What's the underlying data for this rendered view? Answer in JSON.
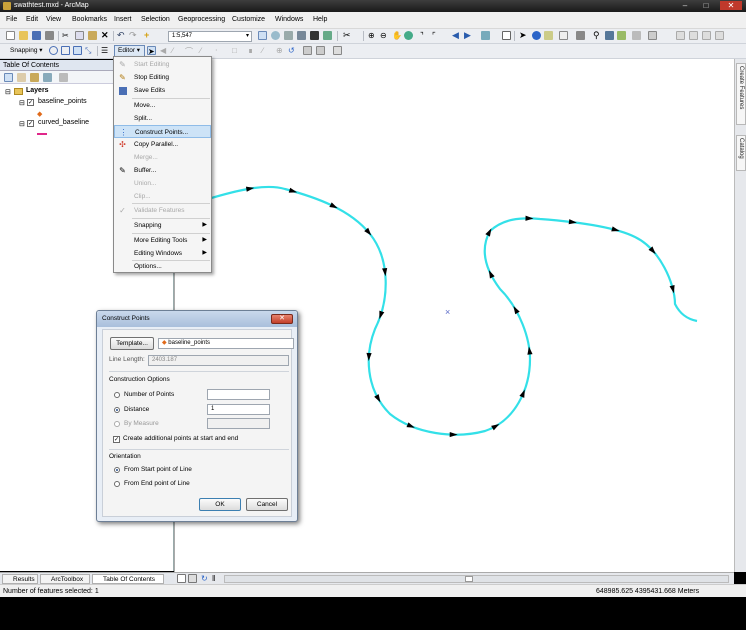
{
  "window": {
    "title": "swathtest.mxd - ArcMap"
  },
  "menubar": [
    "File",
    "Edit",
    "View",
    "Bookmarks",
    "Insert",
    "Selection",
    "Geoprocessing",
    "Customize",
    "Windows",
    "Help"
  ],
  "toolbar": {
    "scale": "1:5,547",
    "snapping_label": "Snapping ▾",
    "editor_label": "Editor ▾"
  },
  "toc": {
    "title": "Table Of Contents",
    "root": "Layers",
    "layers": [
      {
        "name": "baseline_points",
        "checked": true,
        "symbol_color": "#e06a1a"
      },
      {
        "name": "curved_baseline",
        "checked": true,
        "symbol_color": "#e0278a"
      }
    ]
  },
  "editor_menu": [
    {
      "label": "Start Editing",
      "enabled": false,
      "icon": "pencil-icon"
    },
    {
      "label": "Stop Editing",
      "enabled": true,
      "icon": "pencil-stop-icon"
    },
    {
      "label": "Save Edits",
      "enabled": true,
      "icon": "save-icon"
    },
    {
      "label": "Move...",
      "enabled": true
    },
    {
      "label": "Split...",
      "enabled": true
    },
    {
      "label": "Construct Points...",
      "enabled": true,
      "highlighted": true,
      "icon": "construct-points-icon"
    },
    {
      "label": "Copy Parallel...",
      "enabled": true,
      "icon": "copy-parallel-icon"
    },
    {
      "label": "Merge...",
      "enabled": false
    },
    {
      "label": "Buffer...",
      "enabled": true,
      "icon": "buffer-icon"
    },
    {
      "label": "Union...",
      "enabled": false
    },
    {
      "label": "Clip...",
      "enabled": false
    },
    {
      "label": "Validate Features",
      "enabled": false,
      "icon": "validate-icon"
    },
    {
      "label": "Snapping",
      "enabled": true,
      "submenu": true
    },
    {
      "label": "More Editing Tools",
      "enabled": true,
      "submenu": true
    },
    {
      "label": "Editing Windows",
      "enabled": true,
      "submenu": true
    },
    {
      "label": "Options...",
      "enabled": true
    }
  ],
  "dialog": {
    "title": "Construct Points",
    "template_button": "Template...",
    "template_value": "baseline_points",
    "line_length_label": "Line Length:",
    "line_length_value": "2403.187",
    "construction_options_label": "Construction Options",
    "number_of_points_label": "Number of Points",
    "number_of_points_value": "",
    "distance_label": "Distance",
    "distance_value": "1",
    "by_measure_label": "By Measure",
    "by_measure_value": "",
    "create_additional_label": "Create additional points at start and end",
    "create_additional_checked": true,
    "selected_option": "Distance",
    "orientation_label": "Orientation",
    "from_start_label": "From Start point of Line",
    "from_end_label": "From End point of Line",
    "selected_orientation": "From Start point of Line",
    "ok_label": "OK",
    "cancel_label": "Cancel"
  },
  "right_tabs": [
    "Create Features",
    "Catalog"
  ],
  "bottom_tabs": [
    "Results",
    "ArcToolbox",
    "Table Of Contents"
  ],
  "statusbar": {
    "left": "Number of features selected: 1",
    "coords": "648985.625  4395431.668 Meters"
  },
  "colors": {
    "line": "#33e0e8",
    "arrow": "#000000",
    "accent": "#cde3f7"
  }
}
